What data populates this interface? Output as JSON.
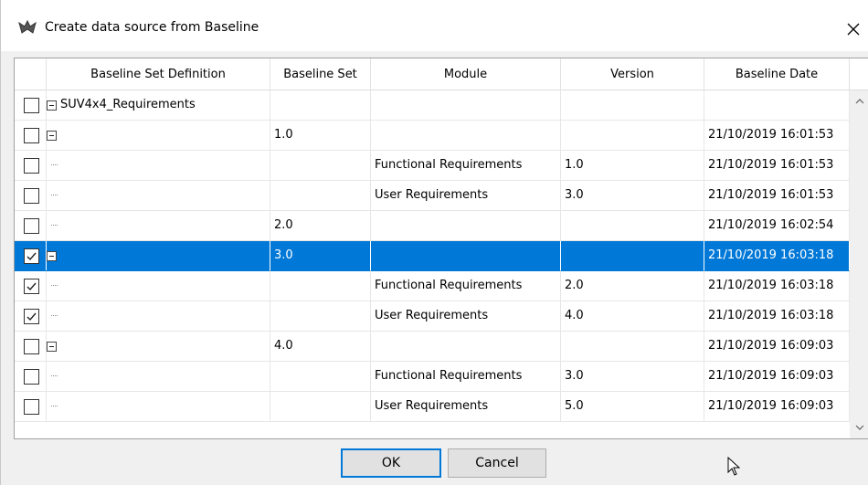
{
  "window": {
    "title": "Create data source from Baseline",
    "icon": "bat-icon",
    "close_glyph": "✕"
  },
  "table": {
    "columns": [
      "Baseline Set Definition",
      "Baseline Set",
      "Module",
      "Version",
      "Baseline Date"
    ],
    "rows": [
      {
        "checked": false,
        "tree": "minus",
        "definition": "SUV4x4_Requirements",
        "set": "",
        "module": "",
        "version": "",
        "date": "",
        "selected": false,
        "indent": 0
      },
      {
        "checked": false,
        "tree": "minus",
        "definition": "",
        "set": "1.0",
        "module": "",
        "version": "",
        "date": "21/10/2019 16:01:53",
        "selected": false,
        "indent": 1
      },
      {
        "checked": false,
        "tree": "dots",
        "definition": "",
        "set": "",
        "module": "Functional Requirements",
        "version": "1.0",
        "date": "21/10/2019 16:01:53",
        "selected": false,
        "indent": 1
      },
      {
        "checked": false,
        "tree": "dots",
        "definition": "",
        "set": "",
        "module": "User Requirements",
        "version": "3.0",
        "date": "21/10/2019 16:01:53",
        "selected": false,
        "indent": 1
      },
      {
        "checked": false,
        "tree": "dots",
        "definition": "",
        "set": "2.0",
        "module": "",
        "version": "",
        "date": "21/10/2019 16:02:54",
        "selected": false,
        "indent": 1
      },
      {
        "checked": true,
        "tree": "minus",
        "definition": "",
        "set": "3.0",
        "module": "",
        "version": "",
        "date": "21/10/2019 16:03:18",
        "selected": true,
        "indent": 1
      },
      {
        "checked": true,
        "tree": "dots",
        "definition": "",
        "set": "",
        "module": "Functional Requirements",
        "version": "2.0",
        "date": "21/10/2019 16:03:18",
        "selected": false,
        "indent": 1
      },
      {
        "checked": true,
        "tree": "dots",
        "definition": "",
        "set": "",
        "module": "User Requirements",
        "version": "4.0",
        "date": "21/10/2019 16:03:18",
        "selected": false,
        "indent": 1
      },
      {
        "checked": false,
        "tree": "minus",
        "definition": "",
        "set": "4.0",
        "module": "",
        "version": "",
        "date": "21/10/2019 16:09:03",
        "selected": false,
        "indent": 1
      },
      {
        "checked": false,
        "tree": "dots",
        "definition": "",
        "set": "",
        "module": "Functional Requirements",
        "version": "3.0",
        "date": "21/10/2019 16:09:03",
        "selected": false,
        "indent": 1
      },
      {
        "checked": false,
        "tree": "dots",
        "definition": "",
        "set": "",
        "module": "User Requirements",
        "version": "5.0",
        "date": "21/10/2019 16:09:03",
        "selected": false,
        "indent": 1
      }
    ]
  },
  "scrollbar": {
    "up_glyph": "^",
    "down_glyph": "v"
  },
  "buttons": {
    "ok": "OK",
    "cancel": "Cancel"
  },
  "colors": {
    "selection": "#0078d7",
    "default_button_border": "#0078d7"
  }
}
